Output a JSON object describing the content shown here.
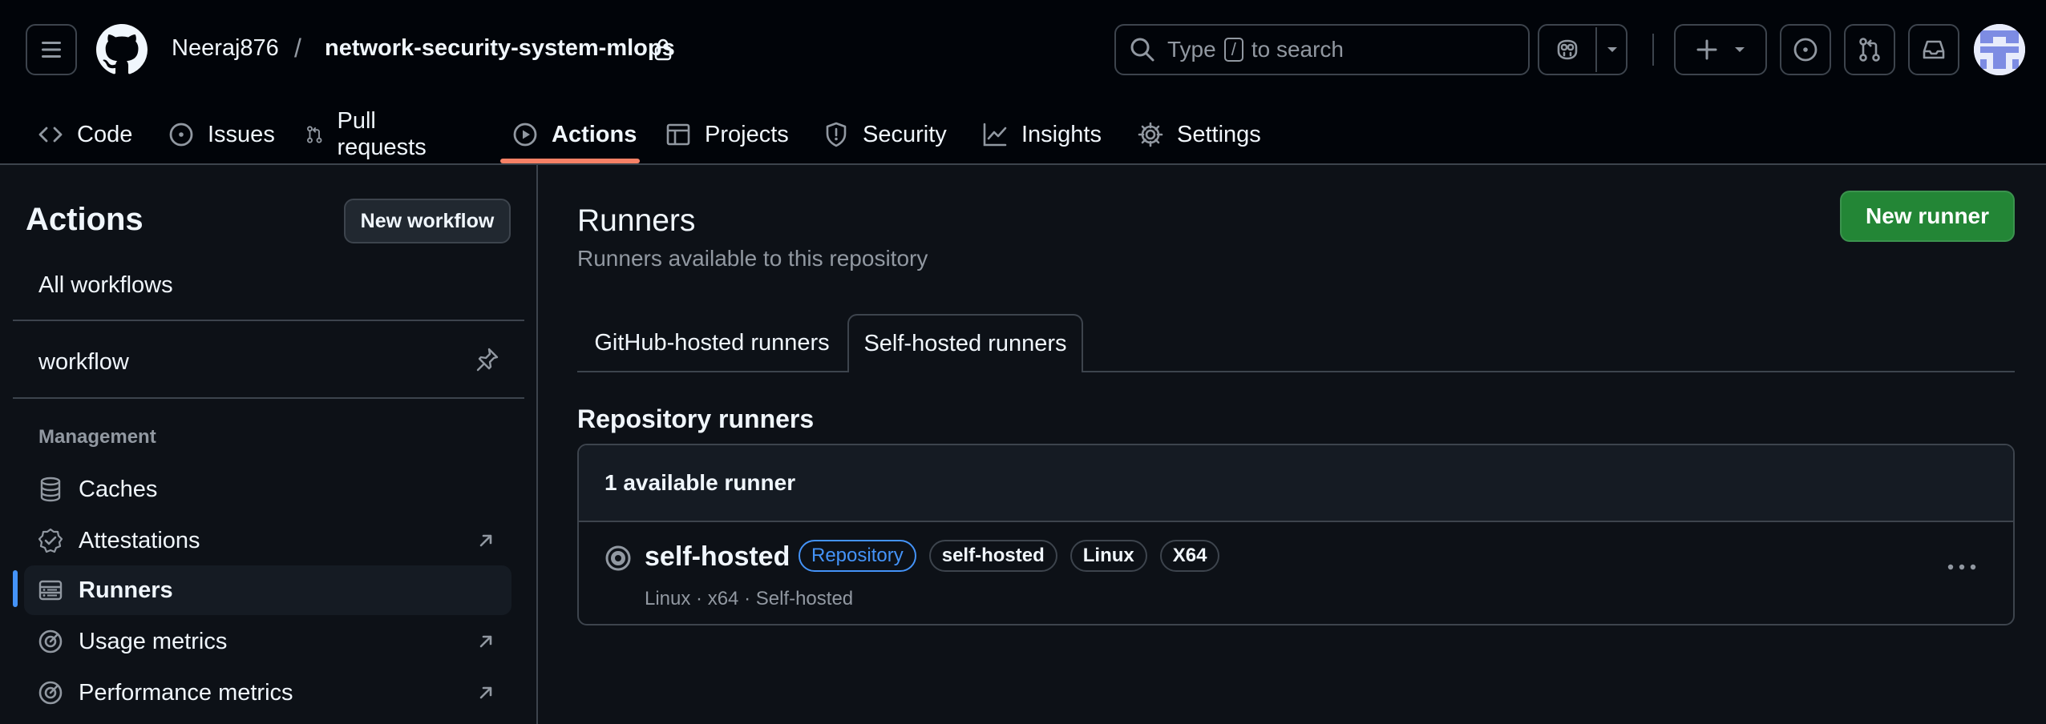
{
  "header": {
    "owner": "Neeraj876",
    "separator": "/",
    "repo": "network-security-system-mlops",
    "search": {
      "prefix": "Type",
      "key": "/",
      "suffix": "to search"
    }
  },
  "nav": {
    "items": [
      {
        "label": "Code",
        "icon": "code-icon"
      },
      {
        "label": "Issues",
        "icon": "issue-opened-icon"
      },
      {
        "label": "Pull requests",
        "icon": "git-pull-request-icon"
      },
      {
        "label": "Actions",
        "icon": "play-icon",
        "active": true
      },
      {
        "label": "Projects",
        "icon": "table-icon"
      },
      {
        "label": "Security",
        "icon": "shield-icon"
      },
      {
        "label": "Insights",
        "icon": "graph-icon"
      },
      {
        "label": "Settings",
        "icon": "gear-icon"
      }
    ]
  },
  "sidebar": {
    "title": "Actions",
    "new_workflow": "New workflow",
    "all_workflows": "All workflows",
    "workflow": "workflow",
    "management_heading": "Management",
    "items": [
      {
        "label": "Caches",
        "icon": "database-icon"
      },
      {
        "label": "Attestations",
        "icon": "verified-icon",
        "external": true
      },
      {
        "label": "Runners",
        "icon": "server-icon",
        "active": true
      },
      {
        "label": "Usage metrics",
        "icon": "meter-icon",
        "external": true
      },
      {
        "label": "Performance metrics",
        "icon": "meter-icon",
        "external": true
      }
    ]
  },
  "main": {
    "title": "Runners",
    "subtitle": "Runners available to this repository",
    "new_runner": "New runner",
    "tabs": [
      {
        "label": "GitHub-hosted runners",
        "active": false
      },
      {
        "label": "Self-hosted runners",
        "active": true
      }
    ],
    "section_title": "Repository runners",
    "runners_count": "1 available runner",
    "runner": {
      "name": "self-hosted",
      "labels": [
        "Repository",
        "self-hosted",
        "Linux",
        "X64"
      ],
      "meta": "Linux · x64 · Self-hosted"
    }
  },
  "colors": {
    "background": "#0d1117",
    "header_bg": "#010409",
    "border": "#3d444d",
    "accent_blue": "#4493f8",
    "primary_green": "#238636",
    "nav_underline": "#f78166",
    "muted_text": "#9198a1"
  }
}
